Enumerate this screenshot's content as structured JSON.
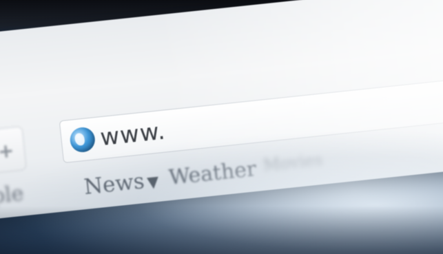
{
  "address_bar": {
    "url": "www.",
    "globe_icon": "globe-icon"
  },
  "new_tab": {
    "label": "+"
  },
  "bookmarks": {
    "apple": "pple",
    "news": "News",
    "news_caret": "▼",
    "weather": "Weather",
    "blurred": "Movies"
  },
  "colors": {
    "chrome": "#eef0f2",
    "globe": "#3e97d8",
    "background": "#2f4a69"
  }
}
